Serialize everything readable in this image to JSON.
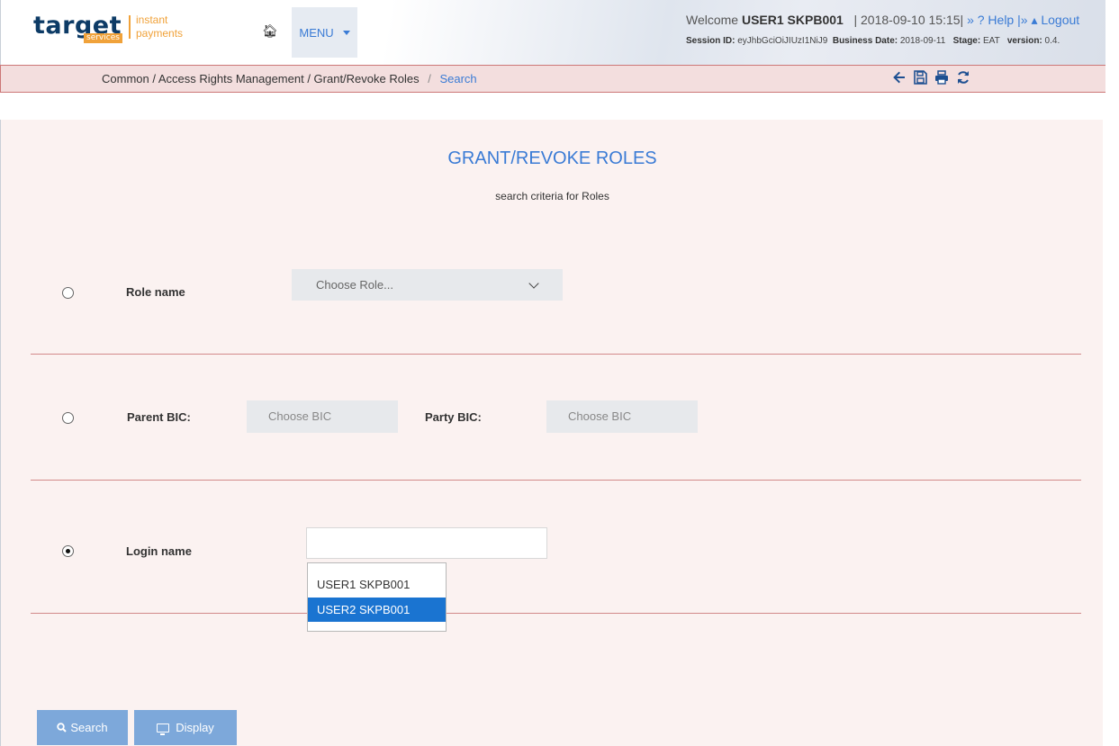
{
  "header": {
    "logo": {
      "word": "target",
      "services": "services",
      "instant": "instant",
      "payments": "payments"
    },
    "menu_label": "MENU",
    "welcome_prefix": "Welcome",
    "user": "USER1 SKPB001",
    "datetime": "| 2018-09-10 15:15|",
    "help_label": "» ? Help",
    "logout_label": "|» ▴ Logout",
    "session_label": "Session ID:",
    "session_id": "eyJhbGciOiJIUzI1NiJ9",
    "business_date_label": "Business Date:",
    "business_date": "2018-09-11",
    "stage_label": "Stage:",
    "stage": "EAT",
    "version_label": "version:",
    "version": "0.4."
  },
  "breadcrumb": {
    "path": "Common / Access Rights Management / Grant/Revoke Roles",
    "sep": "/",
    "current": "Search"
  },
  "main": {
    "title": "GRANT/REVOKE ROLES",
    "subtitle": "search criteria for Roles",
    "role_name_label": "Role name",
    "role_placeholder": "Choose Role...",
    "parent_bic_label": "Parent BIC:",
    "parent_bic_placeholder": "Choose BIC",
    "party_bic_label": "Party BIC:",
    "party_bic_placeholder": "Choose BIC",
    "login_name_label": "Login name",
    "login_value": "",
    "selected_option": "login_name",
    "dropdown_options": [
      "USER1 SKPB001",
      "USER2 SKPB001"
    ],
    "dropdown_highlighted": "USER2 SKPB001"
  },
  "buttons": {
    "search": "Search",
    "display": "Display"
  },
  "colors": {
    "accent": "#3a7bd5",
    "brand_orange": "#f0a23a",
    "brand_navy": "#0d3b66",
    "button": "#7da8da",
    "selected_option": "#1a74d1"
  }
}
